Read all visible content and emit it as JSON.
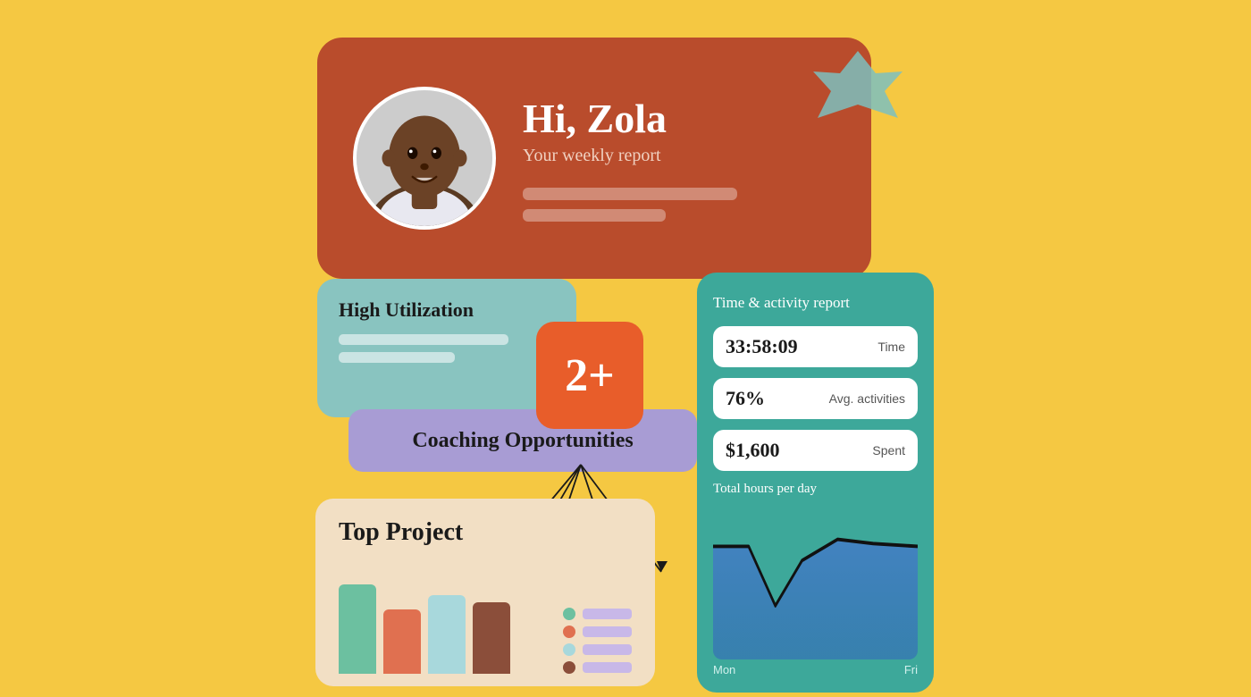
{
  "page": {
    "background_color": "#F5C842"
  },
  "welcome_card": {
    "greeting": "Hi, Zola",
    "subtitle": "Your weekly report",
    "background_color": "#B94C2C"
  },
  "utilization_card": {
    "title": "High Utilization",
    "background_color": "#89C4C0"
  },
  "badge": {
    "value": "2+",
    "background_color": "#E85D2A"
  },
  "coaching_card": {
    "label": "Coaching Opportunities",
    "background_color": "#A89CD4"
  },
  "top_project_card": {
    "title": "Top Project",
    "background_color": "#F2DFC4"
  },
  "activity_card": {
    "title": "Time & activity report",
    "background_color": "#3DA89A",
    "stats": [
      {
        "value": "33:58:09",
        "label": "Time"
      },
      {
        "value": "76%",
        "label": "Avg. activities"
      },
      {
        "value": "$1,600",
        "label": "Spent"
      }
    ],
    "chart": {
      "title": "Total hours per day",
      "x_labels": [
        "Mon",
        "Fri"
      ]
    }
  }
}
